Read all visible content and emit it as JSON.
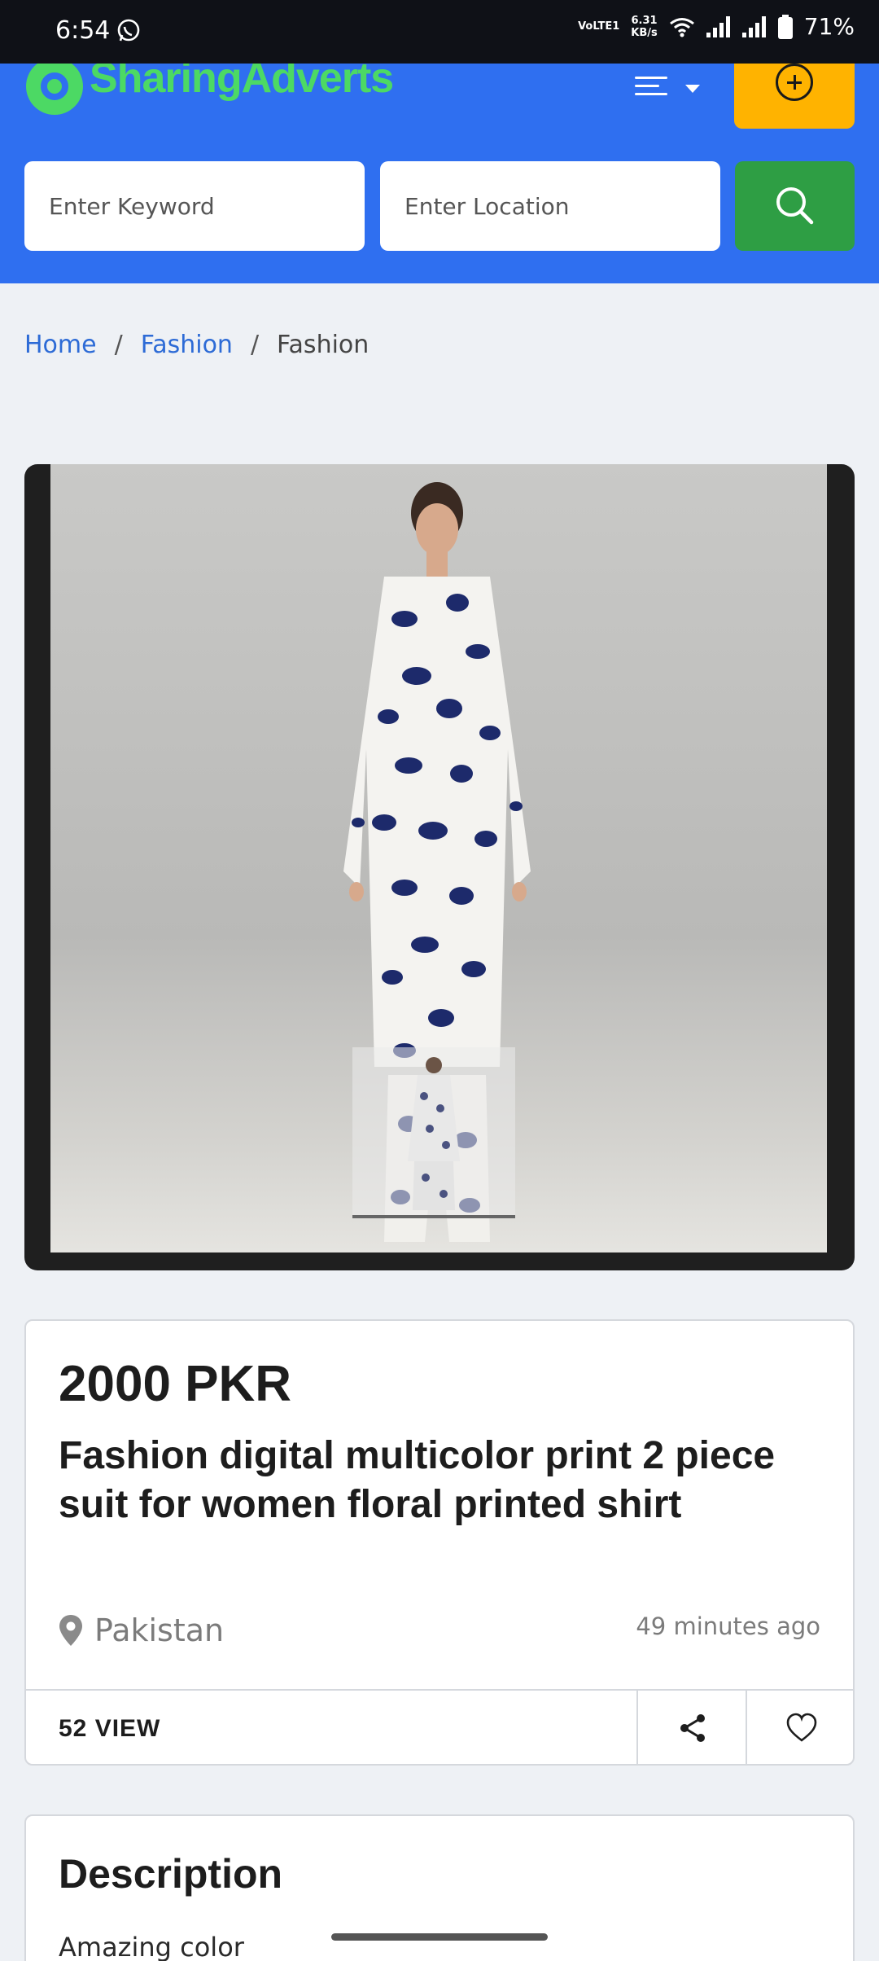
{
  "status_bar": {
    "time": "6:54",
    "network_label": "VoLTE1",
    "speed_value": "6.31",
    "speed_unit": "KB/s",
    "battery": "71%"
  },
  "header": {
    "logo_primary": "Sharing",
    "logo_secondary": "Adverts",
    "keyword_placeholder": "Enter Keyword",
    "location_placeholder": "Enter Location",
    "accent_color": "#2f6ff0",
    "post_button_color": "#ffb300",
    "search_button_color": "#2e9e44"
  },
  "breadcrumb": {
    "items": [
      "Home",
      "Fashion",
      "Fashion"
    ],
    "separator": "/"
  },
  "listing": {
    "price": "2000 PKR",
    "title": "Fashion digital multicolor print 2 piece suit for women floral printed shirt",
    "location": "Pakistan",
    "posted": "49 minutes ago",
    "views": "52 VIEW"
  },
  "description": {
    "heading": "Description",
    "text": "Amazing color"
  }
}
